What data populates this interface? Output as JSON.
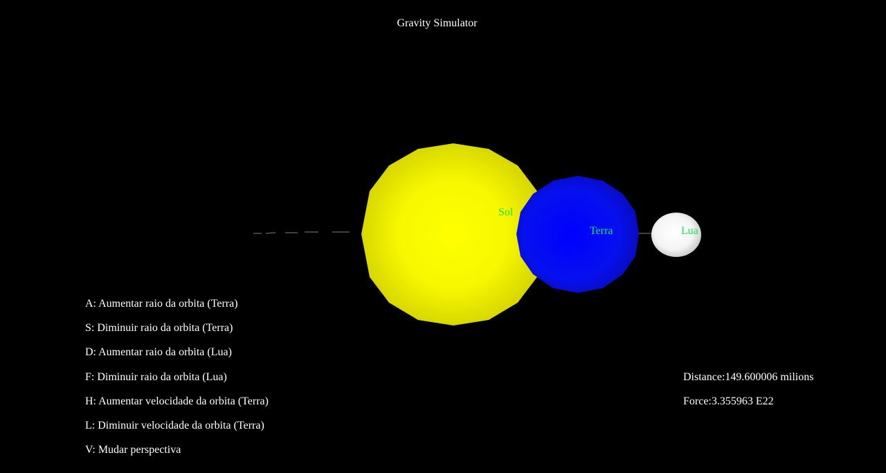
{
  "window": {
    "title": "Gravity Simulator"
  },
  "bodies": {
    "sun": {
      "label": "Sol",
      "color": "#f5f500",
      "label_color": "#14e650"
    },
    "earth": {
      "label": "Terra",
      "color": "#0a14e6",
      "label_color": "#14e650"
    },
    "moon": {
      "label": "Lua",
      "color": "#f2f2f2",
      "label_color": "#14e650"
    }
  },
  "help": [
    "A: Aumentar raio da orbita (Terra)",
    "S: Diminuir raio da orbita (Terra)",
    "D: Aumentar raio da orbita (Lua)",
    "F: Diminuir raio da orbita (Lua)",
    "H: Aumentar velocidade da orbita (Terra)",
    "L: Diminuir velocidade da orbita (Terra)",
    "V: Mudar perspectiva"
  ],
  "stats": {
    "distance": "Distance:149.600006 milions",
    "force": "Force:3.355963 E22"
  }
}
